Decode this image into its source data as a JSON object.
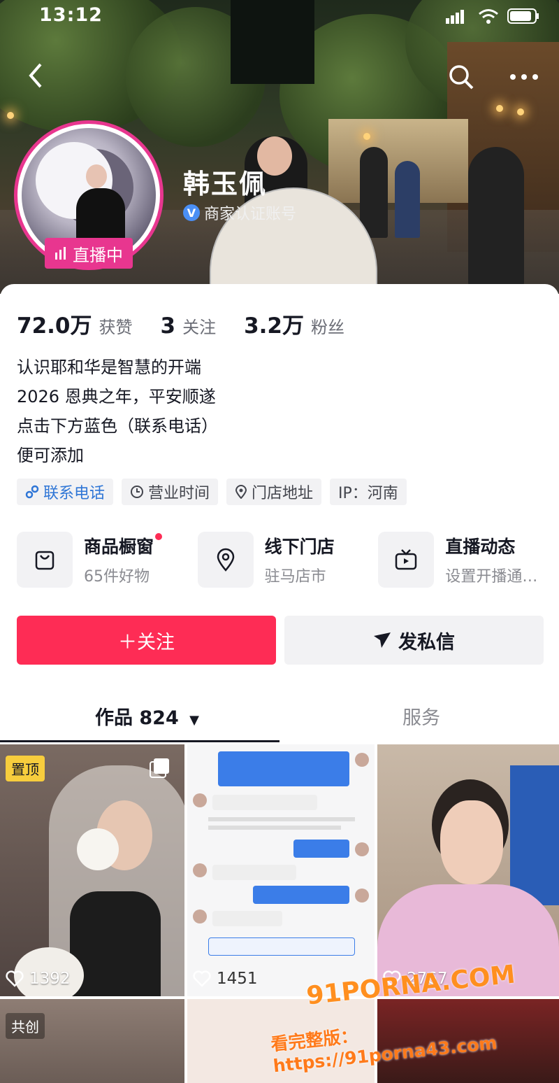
{
  "status_bar": {
    "time": "13:12"
  },
  "profile": {
    "username": "韩玉佩",
    "verify_label": "商家认证账号",
    "live_label": "直播中",
    "stats": [
      {
        "value": "72.0万",
        "label": "获赞"
      },
      {
        "value": "3",
        "label": "关注"
      },
      {
        "value": "3.2万",
        "label": "粉丝"
      }
    ],
    "bio": [
      "认识耶和华是智慧的开端",
      "2026 恩典之年，平安顺遂",
      "点击下方蓝色（联系电话）",
      "便可添加"
    ],
    "tags": [
      {
        "label": "联系电话",
        "icon": "link-icon"
      },
      {
        "label": "营业时间",
        "icon": "clock-icon"
      },
      {
        "label": "门店地址",
        "icon": "location-icon"
      },
      {
        "label": "IP：河南",
        "icon": ""
      }
    ],
    "cards": [
      {
        "title": "商品橱窗",
        "sub": "65件好物",
        "icon": "shopping-bag-icon"
      },
      {
        "title": "线下门店",
        "sub": "驻马店市",
        "icon": "location-pin-icon"
      },
      {
        "title": "直播动态",
        "sub": "设置开播通…",
        "icon": "tv-icon"
      }
    ],
    "follow_label": "＋关注",
    "message_label": "发私信"
  },
  "tabs": [
    {
      "label": "作品 824",
      "active": true
    },
    {
      "label": "服务",
      "active": false
    }
  ],
  "videos": [
    {
      "likes": "1392",
      "badge": "置顶"
    },
    {
      "likes": "1451",
      "badge": ""
    },
    {
      "likes": "2767",
      "badge": ""
    },
    {
      "likes": "",
      "badge": "共创"
    }
  ],
  "watermark": {
    "line1": "91PORNA.COM",
    "line2": "看完整版：https://91porna43.com"
  },
  "colors": {
    "accent": "#fe2c55",
    "live": "#e8368f",
    "link": "#2f76d6"
  }
}
